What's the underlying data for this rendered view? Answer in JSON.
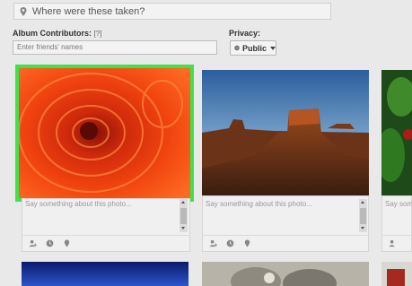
{
  "location": {
    "placeholder": "Where were these taken?"
  },
  "contributors": {
    "label": "Album Contributors:",
    "help": "[?]",
    "placeholder": "Enter friends' names"
  },
  "privacy": {
    "label": "Privacy:",
    "value": "Public"
  },
  "photos": [
    {
      "subject": "orange chrysanthemum",
      "caption_placeholder": "Say something about this photo...",
      "selected": true
    },
    {
      "subject": "desert mesa at sunset",
      "caption_placeholder": "Say something about this photo...",
      "selected": false
    },
    {
      "subject": "green leaves with red flower",
      "caption_placeholder": "Say something about this photo...",
      "selected": false
    }
  ],
  "photo_tools": [
    "tag-person-icon",
    "date-icon",
    "location-icon"
  ],
  "colors": {
    "selected_border": "#3ee24a",
    "background": "#e9e9e9"
  }
}
